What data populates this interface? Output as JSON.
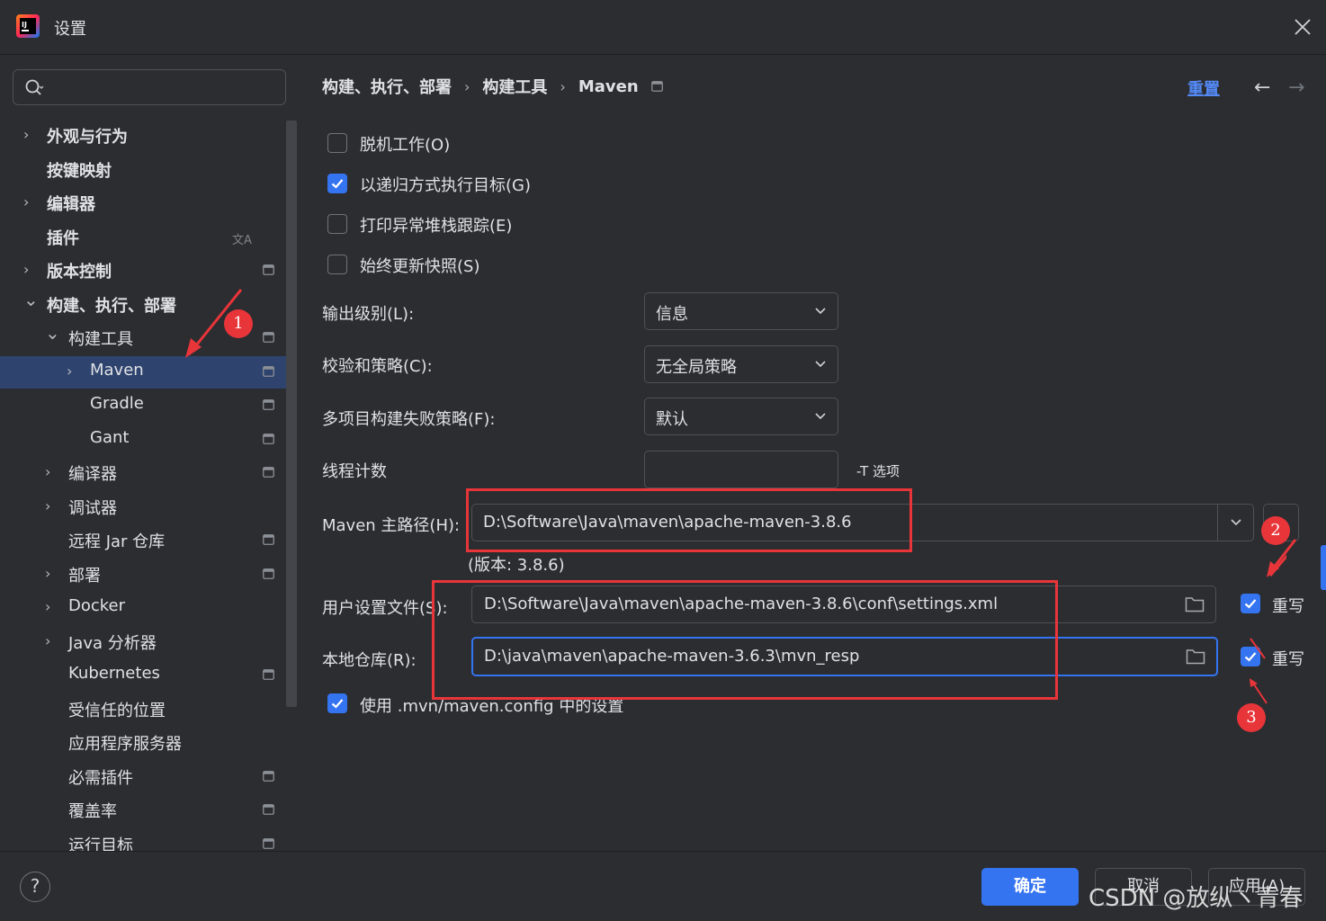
{
  "window": {
    "title": "设置",
    "close_icon": "close-icon"
  },
  "search": {
    "placeholder": ""
  },
  "sidebar": {
    "items": [
      {
        "label": "外观与行为",
        "bold": true,
        "expand": "collapsed"
      },
      {
        "label": "按键映射",
        "bold": true
      },
      {
        "label": "编辑器",
        "bold": true,
        "expand": "collapsed"
      },
      {
        "label": "插件",
        "bold": true,
        "icon": "translate-icon"
      },
      {
        "label": "版本控制",
        "bold": true,
        "expand": "collapsed",
        "icon": "window-icon"
      },
      {
        "label": "构建、执行、部署",
        "bold": true,
        "expand": "expanded"
      },
      {
        "label": "构建工具",
        "expand": "expanded",
        "icon": "window-icon"
      },
      {
        "label": "Maven",
        "expand": "collapsed",
        "icon": "window-icon",
        "selected": true
      },
      {
        "label": "Gradle",
        "icon": "window-icon"
      },
      {
        "label": "Gant",
        "icon": "window-icon"
      },
      {
        "label": "编译器",
        "expand": "collapsed",
        "icon": "window-icon"
      },
      {
        "label": "调试器",
        "expand": "collapsed"
      },
      {
        "label": "远程 Jar 仓库",
        "icon": "window-icon"
      },
      {
        "label": "部署",
        "expand": "collapsed",
        "icon": "window-icon"
      },
      {
        "label": "Docker",
        "expand": "collapsed"
      },
      {
        "label": "Java 分析器",
        "expand": "collapsed"
      },
      {
        "label": "Kubernetes",
        "icon": "window-icon"
      },
      {
        "label": "受信任的位置"
      },
      {
        "label": "应用程序服务器"
      },
      {
        "label": "必需插件",
        "icon": "window-icon"
      },
      {
        "label": "覆盖率",
        "icon": "window-icon"
      },
      {
        "label": "运行目标",
        "icon": "window-icon"
      }
    ]
  },
  "breadcrumb": {
    "part1": "构建、执行、部署",
    "part2": "构建工具",
    "part3": "Maven"
  },
  "header": {
    "reset_label": "重置"
  },
  "options": {
    "offline": {
      "label": "脱机工作(O)",
      "checked": false
    },
    "recursive": {
      "label": "以递归方式执行目标(G)",
      "checked": true
    },
    "print_stack": {
      "label": "打印异常堆栈跟踪(E)",
      "checked": false
    },
    "update_snapshots": {
      "label": "始终更新快照(S)",
      "checked": false
    }
  },
  "form": {
    "output_level": {
      "label": "输出级别(L):",
      "value": "信息"
    },
    "checksum_policy": {
      "label": "校验和策略(C):",
      "value": "无全局策略"
    },
    "fail_policy": {
      "label": "多项目构建失败策略(F):",
      "value": "默认"
    },
    "threads": {
      "label": "线程计数",
      "value": "",
      "hint": "-T 选项"
    },
    "maven_home": {
      "label": "Maven 主路径(H):",
      "value": "D:\\Software\\Java\\maven\\apache-maven-3.8.6",
      "version": "(版本: 3.8.6)"
    },
    "user_settings": {
      "label": "用户设置文件(S):",
      "value": "D:\\Software\\Java\\maven\\apache-maven-3.8.6\\conf\\settings.xml",
      "override_label": "重写",
      "override": true
    },
    "local_repo": {
      "label": "本地仓库(R):",
      "value": "D:\\java\\maven\\apache-maven-3.6.3\\mvn_resp",
      "override_label": "重写",
      "override": true
    },
    "use_mvn_config": {
      "label": "使用 .mvn/maven.config 中的设置",
      "checked": true
    }
  },
  "footer": {
    "help": "?",
    "ok": "确定",
    "cancel": "取消",
    "apply": "应用(A)"
  },
  "watermark": "CSDN @放纵ヽ青春",
  "annotations": {
    "badge1": "1",
    "badge2": "2",
    "badge3": "3"
  },
  "colors": {
    "accent": "#3574f0",
    "annotation": "#e8353a",
    "background": "#2b2d30"
  }
}
